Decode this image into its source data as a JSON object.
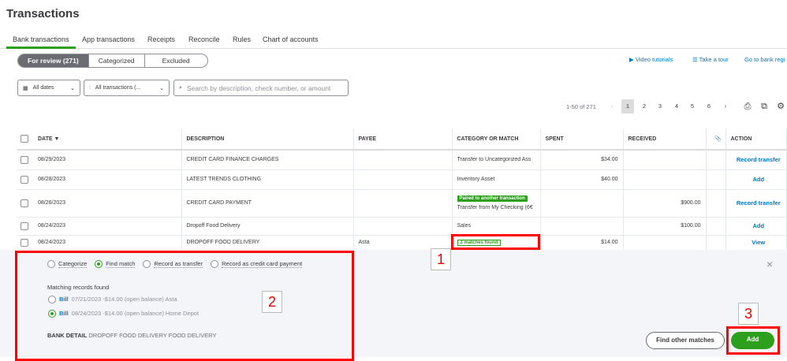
{
  "page_title": "Transactions",
  "tabs": [
    "Bank transactions",
    "App transactions",
    "Receipts",
    "Reconcile",
    "Rules",
    "Chart of accounts"
  ],
  "review_tabs": [
    "For review (271)",
    "Categorized",
    "Excluded"
  ],
  "links": {
    "video": "Video tutorials",
    "tour": "Take a tour",
    "register": "Go to bank regi"
  },
  "filters": {
    "dates": "All dates",
    "transactions": "All transactions (...",
    "search_placeholder": "Search by description, check number, or amount"
  },
  "pagination": {
    "range": "1-50 of 271",
    "pages": [
      "1",
      "2",
      "3",
      "4",
      "5",
      "6"
    ],
    "current": "1"
  },
  "table": {
    "headers": {
      "date": "DATE ▼",
      "description": "DESCRIPTION",
      "payee": "PAYEE",
      "category": "CATEGORY OR MATCH",
      "spent": "SPENT",
      "received": "RECEIVED",
      "action": "ACTION"
    },
    "rows": [
      {
        "date": "08/29/2023",
        "description": "CREDIT CARD FINANCE CHARGES",
        "payee": "",
        "badge": "",
        "category": "Transfer to Uncategorized Ass",
        "spent": "$34.00",
        "received": "",
        "action": "Record transfer"
      },
      {
        "date": "08/28/2023",
        "description": "LATEST TRENDS CLOTHING",
        "payee": "",
        "badge": "",
        "category": "Inventory Asset",
        "spent": "$40.00",
        "received": "",
        "action": "Add"
      },
      {
        "date": "08/26/2023",
        "description": "CREDIT CARD PAYMENT",
        "payee": "",
        "badge": "Paired to another transaction",
        "category": "Transfer from My Checking (6€",
        "spent": "",
        "received": "$900.00",
        "action": "Record transfer"
      },
      {
        "date": "08/24/2023",
        "description": "Dropoff Food Delivery",
        "payee": "",
        "badge": "",
        "category": "Sales",
        "spent": "",
        "received": "$100.00",
        "action": "Add"
      },
      {
        "date": "08/24/2023",
        "description": "DROPOFF FOOD DELIVERY",
        "payee": "Asta",
        "badge": "",
        "category": "2 matches found",
        "spent": "$14.00",
        "received": "",
        "action": "View"
      }
    ]
  },
  "panel": {
    "options": [
      "Categorize",
      "Find match",
      "Record as transfer",
      "Record as credit card payment"
    ],
    "matching_label": "Matching records found",
    "records": [
      {
        "type": "Bill",
        "detail": "07/21/2023 -$14.00 (open balance) Asta",
        "selected": false
      },
      {
        "type": "Bill",
        "detail": "08/24/2023 -$14.00 (open balance) Home Depot",
        "selected": true
      }
    ],
    "bank_detail_label": "BANK DETAIL",
    "bank_detail": "DROPOFF FOOD DELIVERY FOOD DELIVERY",
    "find_other": "Find other matches",
    "add": "Add",
    "close": "×"
  },
  "callouts": [
    "1",
    "2",
    "3"
  ],
  "colors": {
    "accent": "#2ca01c",
    "link": "#0077c5",
    "annotation": "#ff0000"
  }
}
